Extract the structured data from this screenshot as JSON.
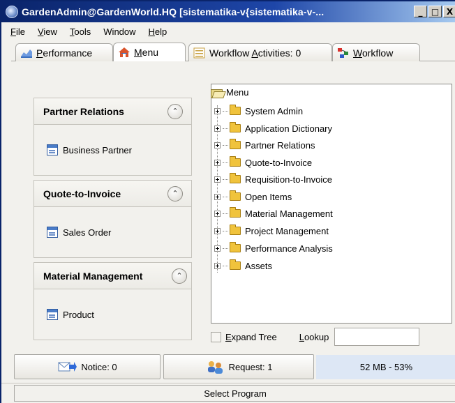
{
  "window": {
    "title": "GardenAdmin@GardenWorld.HQ [sistematika-v{sistematika-v-...",
    "buttons": [
      "_",
      "□",
      "X"
    ]
  },
  "menubar": [
    {
      "mnemonic": "F",
      "rest": "ile"
    },
    {
      "mnemonic": "V",
      "rest": "iew"
    },
    {
      "mnemonic": "T",
      "rest": "ools"
    },
    {
      "mnemonic": "",
      "rest": "Window"
    },
    {
      "mnemonic": "H",
      "rest": "elp"
    }
  ],
  "tabs": [
    {
      "pre": "",
      "mnemonic": "P",
      "post": "erformance",
      "icon": "chart-icon"
    },
    {
      "pre": "",
      "mnemonic": "M",
      "post": "enu",
      "icon": "home-icon",
      "active": true
    },
    {
      "pre": "Workflow ",
      "mnemonic": "A",
      "post": "ctivities: 0",
      "icon": "list-icon"
    },
    {
      "pre": "",
      "mnemonic": "W",
      "post": "orkflow",
      "icon": "workflow-icon"
    }
  ],
  "shortcuts": [
    {
      "title": "Partner Relations",
      "item": "Business Partner"
    },
    {
      "title": "Quote-to-Invoice",
      "item": "Sales Order"
    },
    {
      "title": "Material Management",
      "item": "Product"
    }
  ],
  "tree": {
    "root": "Menu",
    "nodes": [
      "System Admin",
      "Application Dictionary",
      "Partner Relations",
      "Quote-to-Invoice",
      "Requisition-to-Invoice",
      "Open Items",
      "Material Management",
      "Project Management",
      "Performance Analysis",
      "Assets"
    ]
  },
  "tree_controls": {
    "expand_pre": "",
    "expand_mnemonic": "E",
    "expand_post": "xpand Tree",
    "lookup_mnemonic": "L",
    "lookup_post": "ookup",
    "lookup_value": ""
  },
  "status": {
    "notice": "Notice: 0",
    "request": "Request: 1",
    "memory": "52 MB - 53%",
    "footer": "Select Program"
  },
  "colors": {
    "titlebar": "#0a246a",
    "memory_bg": "#dde7f5",
    "folder": "#f0c33c"
  }
}
